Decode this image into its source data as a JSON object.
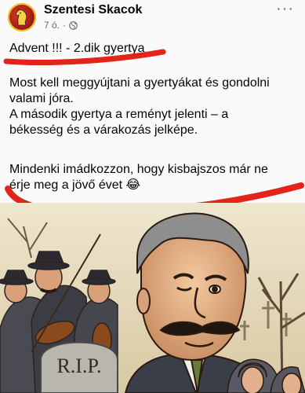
{
  "post": {
    "author": "Szentesi Skacok",
    "time": "7 ó.",
    "separator": "·",
    "more_label": "···"
  },
  "body": {
    "title": "Advent !!! - 2.dik gyertya",
    "paragraph1_line1": "Most kell meggyújtani a gyertyákat és gondolni",
    "paragraph1_line2": "valami jóra.",
    "paragraph1_line3": "A második gyertya a reményt jelenti – a",
    "paragraph1_line4": "békesség és a várakozás jelképe.",
    "paragraph2_line1": "Mindenki imádkozzon, hogy kisbajszos már ne",
    "paragraph2_line2": "érje meg a jövő évet 😂"
  },
  "image": {
    "tombstone_text": "R.I.P."
  },
  "colors": {
    "accent_red": "#e4231b",
    "meta_gray": "#65676b"
  }
}
